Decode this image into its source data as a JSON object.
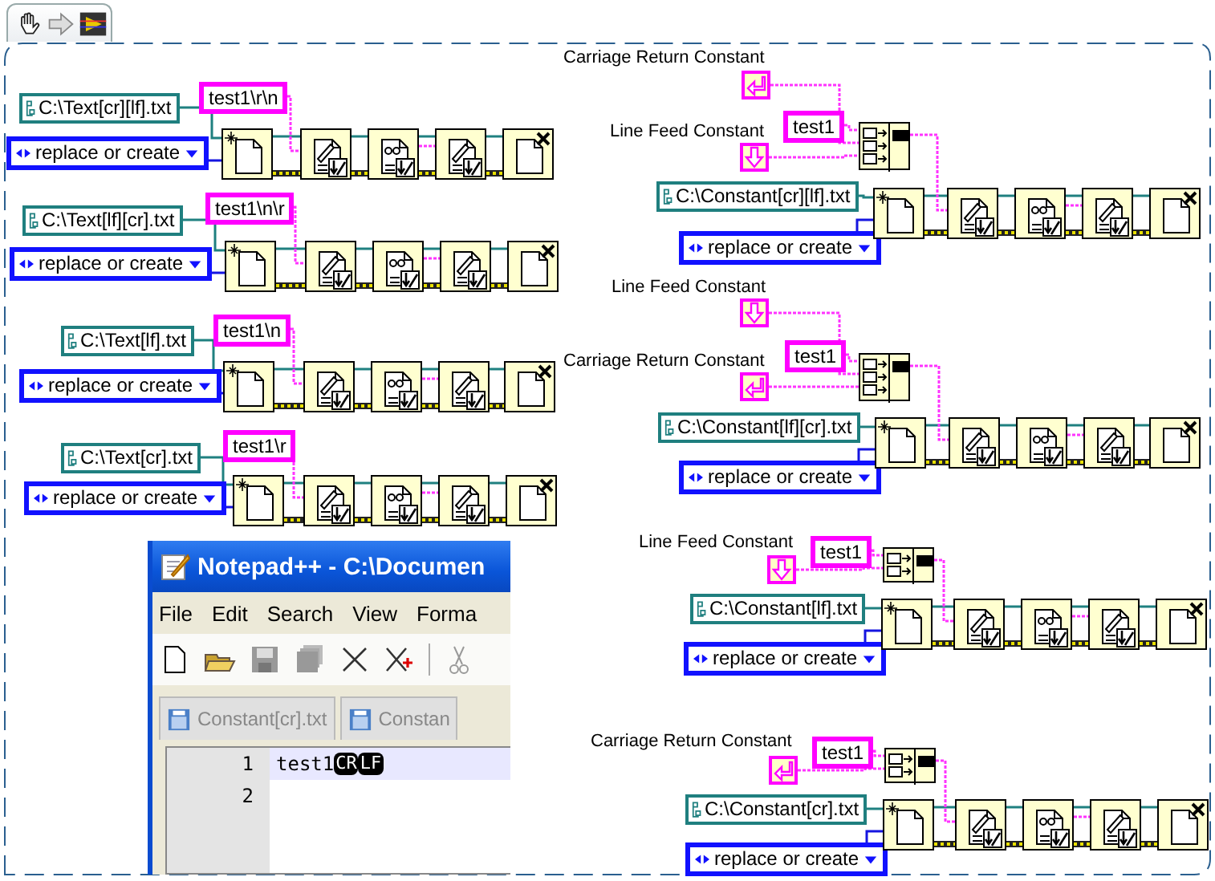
{
  "diagram": {
    "chains": [
      {
        "kind": "string",
        "string": "test1\\r\\n",
        "path": "C:\\Text[cr][lf].txt",
        "mode": "replace or create"
      },
      {
        "kind": "string",
        "string": "test1\\n\\r",
        "path": "C:\\Text[lf][cr].txt",
        "mode": "replace or create"
      },
      {
        "kind": "string",
        "string": "test1\\n",
        "path": "C:\\Text[lf].txt",
        "mode": "replace or create"
      },
      {
        "kind": "string",
        "string": "test1\\r",
        "path": "C:\\Text[cr].txt",
        "mode": "replace or create"
      },
      {
        "kind": "concatenate",
        "constants": [
          {
            "kind": "cr",
            "label": "Carriage Return Constant"
          },
          {
            "kind": "lf",
            "label": "Line Feed Constant"
          }
        ],
        "string": "test1",
        "path": "C:\\Constant[cr][lf].txt",
        "mode": "replace or create"
      },
      {
        "kind": "concatenate",
        "constants": [
          {
            "kind": "lf",
            "label": "Line Feed Constant"
          },
          {
            "kind": "cr",
            "label": "Carriage Return Constant"
          }
        ],
        "string": "test1",
        "path": "C:\\Constant[lf][cr].txt",
        "mode": "replace or create"
      },
      {
        "kind": "concatenate",
        "constants": [
          {
            "kind": "lf",
            "label": "Line Feed Constant"
          }
        ],
        "string": "test1",
        "path": "C:\\Constant[lf].txt",
        "mode": "replace or create"
      },
      {
        "kind": "concatenate",
        "constants": [
          {
            "kind": "cr",
            "label": "Carriage Return Constant"
          }
        ],
        "string": "test1",
        "path": "C:\\Constant[cr].txt",
        "mode": "replace or create"
      }
    ]
  },
  "notepad": {
    "title": "Notepad++ - C:\\Documen",
    "menu": [
      "File",
      "Edit",
      "Search",
      "View",
      "Forma"
    ],
    "tabs": [
      "Constant[cr].txt",
      "Constan"
    ],
    "lines": [
      {
        "number": "1",
        "text": "test1",
        "eol": [
          "CR",
          "LF"
        ]
      },
      {
        "number": "2"
      }
    ]
  }
}
